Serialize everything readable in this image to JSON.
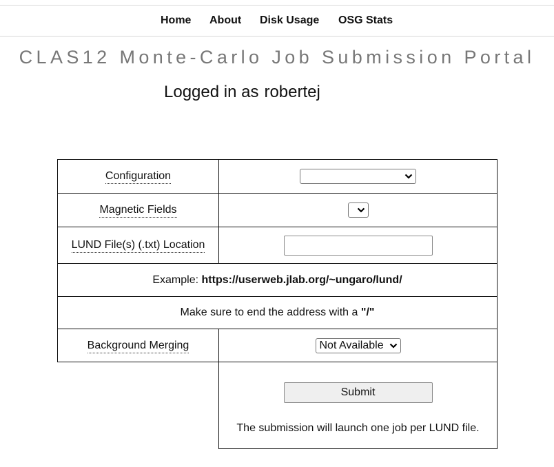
{
  "nav": {
    "home": "Home",
    "about": "About",
    "disk_usage": "Disk Usage",
    "osg_stats": "OSG Stats"
  },
  "header": {
    "title": "CLAS12 Monte-Carlo Job Submission Portal",
    "logged_in_prefix": "Logged in as",
    "username": "robertej"
  },
  "form": {
    "configuration_label": "Configuration",
    "configuration_value": "",
    "magnetic_fields_label": "Magnetic Fields",
    "magnetic_fields_value": "",
    "lund_label": "LUND File(s) (.txt) Location",
    "lund_value": "",
    "example_prefix": "Example:",
    "example_url": "https://userweb.jlab.org/~ungaro/lund/",
    "end_note_prefix": "Make sure to end the address with a",
    "end_note_char": "\"/\"",
    "background_label": "Background Merging",
    "background_value": "Not Available",
    "submit_label": "Submit",
    "submit_note": "The submission will launch one job per LUND file."
  },
  "icons": {
    "dropdown": "chevron-down-icon"
  }
}
